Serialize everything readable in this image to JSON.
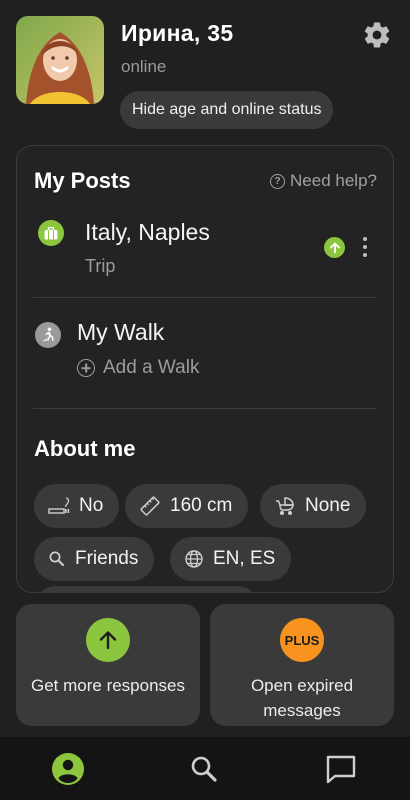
{
  "profile": {
    "name": "Ирина, 35",
    "status": "online",
    "hide_button": "Hide age and online status"
  },
  "posts": {
    "title": "My Posts",
    "help": "Need help?",
    "trip": {
      "title": "Italy, Naples",
      "subtitle": "Trip"
    },
    "walk": {
      "title": "My Walk",
      "add_label": "Add a Walk"
    }
  },
  "about": {
    "title": "About me",
    "chips": [
      {
        "icon": "smoking-icon",
        "label": "No"
      },
      {
        "icon": "ruler-icon",
        "label": "160 cm"
      },
      {
        "icon": "stroller-icon",
        "label": "None"
      },
      {
        "icon": "search-icon",
        "label": "Friends"
      },
      {
        "icon": "globe-icon",
        "label": "EN, ES"
      }
    ]
  },
  "actions": {
    "boost": {
      "label": "Get more responses",
      "icon": "arrow-up-icon"
    },
    "plus": {
      "label": "Open expired messages",
      "badge": "PLUS"
    }
  },
  "nav": {
    "items": [
      "profile-icon",
      "search-icon",
      "chat-icon"
    ],
    "active": "profile-icon"
  },
  "colors": {
    "background": "#202020",
    "accent_green": "#8cc63e",
    "plus_orange": "#f7931e",
    "chip": "#3a3a3a"
  }
}
